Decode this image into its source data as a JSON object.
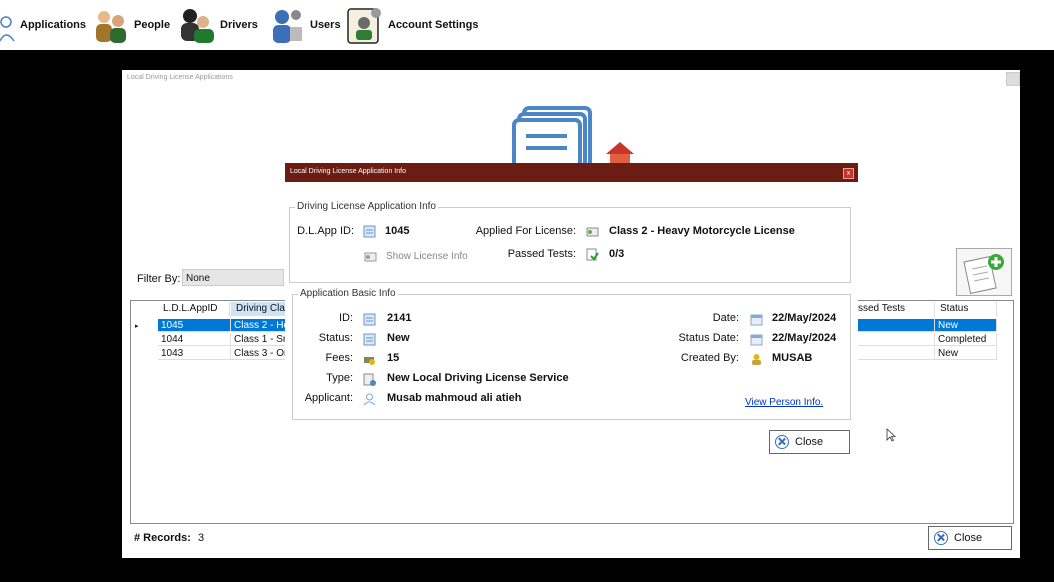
{
  "menu": {
    "items": [
      {
        "label": "Applications",
        "icon": "user-outline-icon"
      },
      {
        "label": "People",
        "icon": "people-icon"
      },
      {
        "label": "Drivers",
        "icon": "drivers-icon"
      },
      {
        "label": "Users",
        "icon": "users-icon"
      },
      {
        "label": "Account Settings",
        "icon": "account-settings-icon"
      }
    ]
  },
  "main_window": {
    "title": "Local Driving License Applications",
    "filter_label": "Filter By:",
    "filter_value": "None",
    "grid": {
      "columns": [
        "L.D.L.AppID",
        "Driving Cla",
        "ssed Tests",
        "Status"
      ],
      "rows": [
        {
          "id": "1045",
          "class": "Class 2 - He",
          "status": "New",
          "selected": true
        },
        {
          "id": "1044",
          "class": "Class 1 - Sn",
          "status": "Completed",
          "selected": false
        },
        {
          "id": "1043",
          "class": "Class 3 - Or",
          "status": "New",
          "selected": false
        }
      ]
    },
    "records_label": "# Records:",
    "records_count": "3",
    "close_label": "Close"
  },
  "dialog": {
    "title": "Local Driving License Application Info",
    "license_group": {
      "title": "Driving License Application Info",
      "dl_app_id_label": "D.L.App ID:",
      "dl_app_id": "1045",
      "applied_for_label": "Applied For License:",
      "applied_for": "Class 2 - Heavy Motorcycle License",
      "show_license_info": "Show License Info",
      "passed_tests_label": "Passed Tests:",
      "passed_tests": "0/3"
    },
    "basic_group": {
      "title": "Application Basic Info",
      "id_label": "ID:",
      "id": "2141",
      "status_label": "Status:",
      "status": "New",
      "fees_label": "Fees:",
      "fees": "15",
      "type_label": "Type:",
      "type": "New Local Driving License Service",
      "applicant_label": "Applicant:",
      "applicant": "Musab mahmoud ali atieh",
      "date_label": "Date:",
      "date": "22/May/2024",
      "status_date_label": "Status Date:",
      "status_date": "22/May/2024",
      "created_by_label": "Created By:",
      "created_by": "MUSAB",
      "view_person_link": "View Person Info."
    },
    "close_label": "Close"
  },
  "colors": {
    "dialog_titlebar": "#6b1d14",
    "selection": "#0078d7",
    "link": "#0033cc"
  }
}
